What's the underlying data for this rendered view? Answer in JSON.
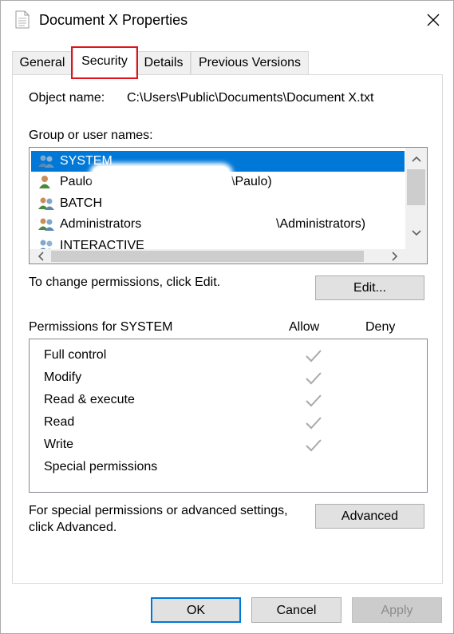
{
  "window": {
    "title": "Document X Properties",
    "title_icon": "document-icon",
    "close_icon": "close-icon"
  },
  "tabs": [
    {
      "label": "General",
      "active": false
    },
    {
      "label": "Security",
      "active": true
    },
    {
      "label": "Details",
      "active": false
    },
    {
      "label": "Previous Versions",
      "active": false
    }
  ],
  "security": {
    "object_name_label": "Object name:",
    "object_name_value": "C:\\Users\\Public\\Documents\\Document X.txt",
    "group_label": "Group or user names:",
    "users": [
      {
        "name": "SYSTEM",
        "suffix": "",
        "icon": "user-group-icon",
        "selected": true
      },
      {
        "name": "Paulo",
        "suffix": "\\Paulo)",
        "icon": "user-icon",
        "selected": false
      },
      {
        "name": "BATCH",
        "suffix": "",
        "icon": "user-group-icon",
        "selected": false
      },
      {
        "name": "Administrators",
        "suffix": "\\Administrators)",
        "icon": "user-group-icon",
        "selected": false
      },
      {
        "name": "INTERACTIVE",
        "suffix": "",
        "icon": "user-group-icon",
        "selected": false
      }
    ],
    "change_perm_text": "To change permissions, click Edit.",
    "edit_button": "Edit...",
    "permissions_header": "Permissions for SYSTEM",
    "allow_header": "Allow",
    "deny_header": "Deny",
    "permissions": [
      {
        "name": "Full control",
        "allow": true,
        "deny": false
      },
      {
        "name": "Modify",
        "allow": true,
        "deny": false
      },
      {
        "name": "Read & execute",
        "allow": true,
        "deny": false
      },
      {
        "name": "Read",
        "allow": true,
        "deny": false
      },
      {
        "name": "Write",
        "allow": true,
        "deny": false
      },
      {
        "name": "Special permissions",
        "allow": false,
        "deny": false
      }
    ],
    "advanced_text_line1": "For special permissions or advanced settings,",
    "advanced_text_line2": "click Advanced.",
    "advanced_button": "Advanced"
  },
  "footer": {
    "ok": "OK",
    "cancel": "Cancel",
    "apply": "Apply",
    "apply_enabled": false
  },
  "colors": {
    "selection": "#0078d7",
    "highlight": "#e0131b",
    "check_disabled": "#a9a9a9"
  }
}
